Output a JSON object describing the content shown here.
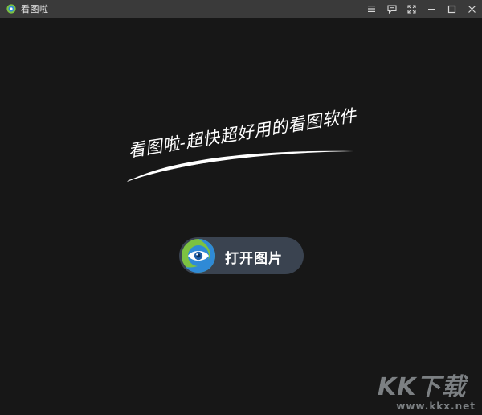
{
  "titlebar": {
    "title": "看图啦",
    "icons": [
      "menu-icon",
      "feedback-icon",
      "fullscreen-icon",
      "minimize-icon",
      "maximize-icon",
      "close-icon"
    ]
  },
  "main": {
    "slogan": "看图啦-超快超好用的看图软件",
    "open_button_label": "打开图片"
  },
  "watermark": {
    "logo_text": "KK下载",
    "site": "www.kkx.net"
  },
  "colors": {
    "background": "#171717",
    "titlebar": "#3a3a3a",
    "button": "#3a4350",
    "logo_green": "#7cc242",
    "logo_blue": "#2f8ad6"
  }
}
